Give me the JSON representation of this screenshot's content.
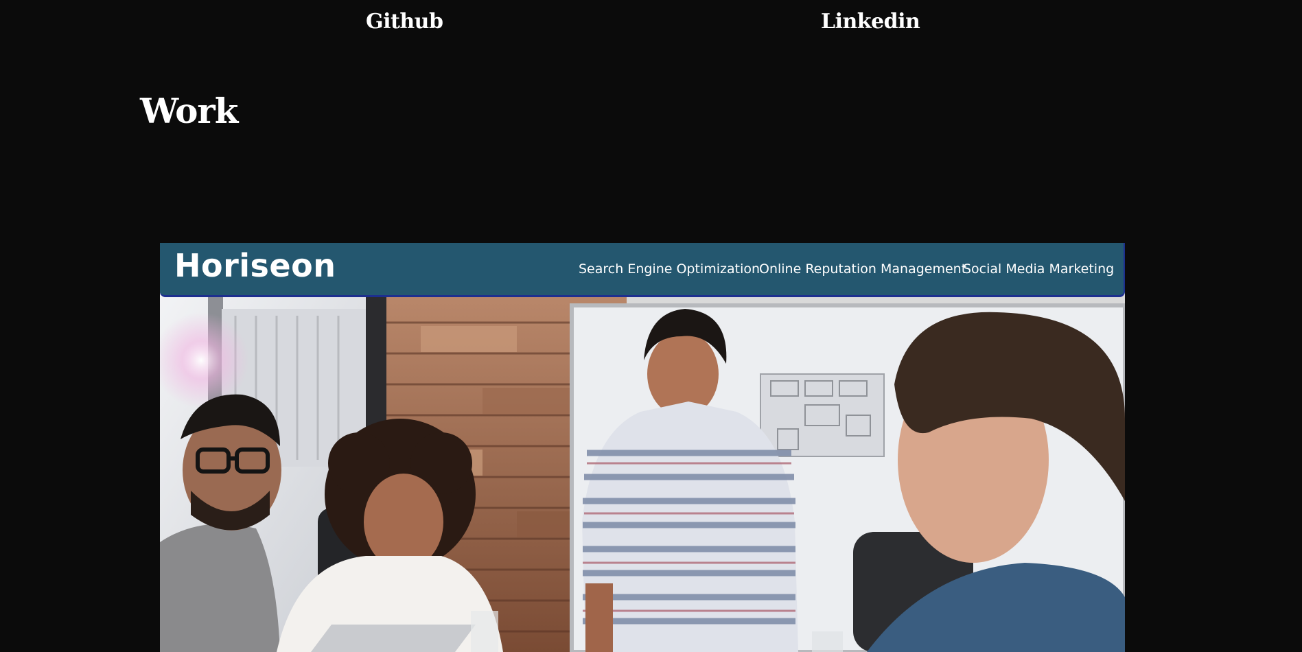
{
  "nav": {
    "github_label": "Github",
    "linkedin_label": "Linkedin"
  },
  "work": {
    "title": "Work"
  },
  "project": {
    "site_logo": "Horiseon",
    "site_nav": [
      "Search Engine Optimization",
      "Online Reputation Management",
      "Social Media Marketing"
    ],
    "header_color": "#24576f"
  },
  "colors": {
    "background": "#0b0b0b",
    "text": "#ffffff"
  }
}
